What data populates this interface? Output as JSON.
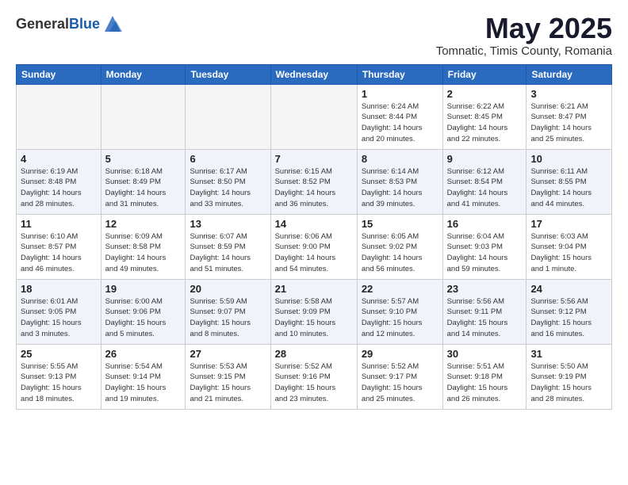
{
  "header": {
    "logo_general": "General",
    "logo_blue": "Blue",
    "month_title": "May 2025",
    "location": "Tomnatic, Timis County, Romania"
  },
  "weekdays": [
    "Sunday",
    "Monday",
    "Tuesday",
    "Wednesday",
    "Thursday",
    "Friday",
    "Saturday"
  ],
  "weeks": [
    [
      {
        "day": "",
        "info": ""
      },
      {
        "day": "",
        "info": ""
      },
      {
        "day": "",
        "info": ""
      },
      {
        "day": "",
        "info": ""
      },
      {
        "day": "1",
        "info": "Sunrise: 6:24 AM\nSunset: 8:44 PM\nDaylight: 14 hours\nand 20 minutes."
      },
      {
        "day": "2",
        "info": "Sunrise: 6:22 AM\nSunset: 8:45 PM\nDaylight: 14 hours\nand 22 minutes."
      },
      {
        "day": "3",
        "info": "Sunrise: 6:21 AM\nSunset: 8:47 PM\nDaylight: 14 hours\nand 25 minutes."
      }
    ],
    [
      {
        "day": "4",
        "info": "Sunrise: 6:19 AM\nSunset: 8:48 PM\nDaylight: 14 hours\nand 28 minutes."
      },
      {
        "day": "5",
        "info": "Sunrise: 6:18 AM\nSunset: 8:49 PM\nDaylight: 14 hours\nand 31 minutes."
      },
      {
        "day": "6",
        "info": "Sunrise: 6:17 AM\nSunset: 8:50 PM\nDaylight: 14 hours\nand 33 minutes."
      },
      {
        "day": "7",
        "info": "Sunrise: 6:15 AM\nSunset: 8:52 PM\nDaylight: 14 hours\nand 36 minutes."
      },
      {
        "day": "8",
        "info": "Sunrise: 6:14 AM\nSunset: 8:53 PM\nDaylight: 14 hours\nand 39 minutes."
      },
      {
        "day": "9",
        "info": "Sunrise: 6:12 AM\nSunset: 8:54 PM\nDaylight: 14 hours\nand 41 minutes."
      },
      {
        "day": "10",
        "info": "Sunrise: 6:11 AM\nSunset: 8:55 PM\nDaylight: 14 hours\nand 44 minutes."
      }
    ],
    [
      {
        "day": "11",
        "info": "Sunrise: 6:10 AM\nSunset: 8:57 PM\nDaylight: 14 hours\nand 46 minutes."
      },
      {
        "day": "12",
        "info": "Sunrise: 6:09 AM\nSunset: 8:58 PM\nDaylight: 14 hours\nand 49 minutes."
      },
      {
        "day": "13",
        "info": "Sunrise: 6:07 AM\nSunset: 8:59 PM\nDaylight: 14 hours\nand 51 minutes."
      },
      {
        "day": "14",
        "info": "Sunrise: 6:06 AM\nSunset: 9:00 PM\nDaylight: 14 hours\nand 54 minutes."
      },
      {
        "day": "15",
        "info": "Sunrise: 6:05 AM\nSunset: 9:02 PM\nDaylight: 14 hours\nand 56 minutes."
      },
      {
        "day": "16",
        "info": "Sunrise: 6:04 AM\nSunset: 9:03 PM\nDaylight: 14 hours\nand 59 minutes."
      },
      {
        "day": "17",
        "info": "Sunrise: 6:03 AM\nSunset: 9:04 PM\nDaylight: 15 hours\nand 1 minute."
      }
    ],
    [
      {
        "day": "18",
        "info": "Sunrise: 6:01 AM\nSunset: 9:05 PM\nDaylight: 15 hours\nand 3 minutes."
      },
      {
        "day": "19",
        "info": "Sunrise: 6:00 AM\nSunset: 9:06 PM\nDaylight: 15 hours\nand 5 minutes."
      },
      {
        "day": "20",
        "info": "Sunrise: 5:59 AM\nSunset: 9:07 PM\nDaylight: 15 hours\nand 8 minutes."
      },
      {
        "day": "21",
        "info": "Sunrise: 5:58 AM\nSunset: 9:09 PM\nDaylight: 15 hours\nand 10 minutes."
      },
      {
        "day": "22",
        "info": "Sunrise: 5:57 AM\nSunset: 9:10 PM\nDaylight: 15 hours\nand 12 minutes."
      },
      {
        "day": "23",
        "info": "Sunrise: 5:56 AM\nSunset: 9:11 PM\nDaylight: 15 hours\nand 14 minutes."
      },
      {
        "day": "24",
        "info": "Sunrise: 5:56 AM\nSunset: 9:12 PM\nDaylight: 15 hours\nand 16 minutes."
      }
    ],
    [
      {
        "day": "25",
        "info": "Sunrise: 5:55 AM\nSunset: 9:13 PM\nDaylight: 15 hours\nand 18 minutes."
      },
      {
        "day": "26",
        "info": "Sunrise: 5:54 AM\nSunset: 9:14 PM\nDaylight: 15 hours\nand 19 minutes."
      },
      {
        "day": "27",
        "info": "Sunrise: 5:53 AM\nSunset: 9:15 PM\nDaylight: 15 hours\nand 21 minutes."
      },
      {
        "day": "28",
        "info": "Sunrise: 5:52 AM\nSunset: 9:16 PM\nDaylight: 15 hours\nand 23 minutes."
      },
      {
        "day": "29",
        "info": "Sunrise: 5:52 AM\nSunset: 9:17 PM\nDaylight: 15 hours\nand 25 minutes."
      },
      {
        "day": "30",
        "info": "Sunrise: 5:51 AM\nSunset: 9:18 PM\nDaylight: 15 hours\nand 26 minutes."
      },
      {
        "day": "31",
        "info": "Sunrise: 5:50 AM\nSunset: 9:19 PM\nDaylight: 15 hours\nand 28 minutes."
      }
    ]
  ]
}
